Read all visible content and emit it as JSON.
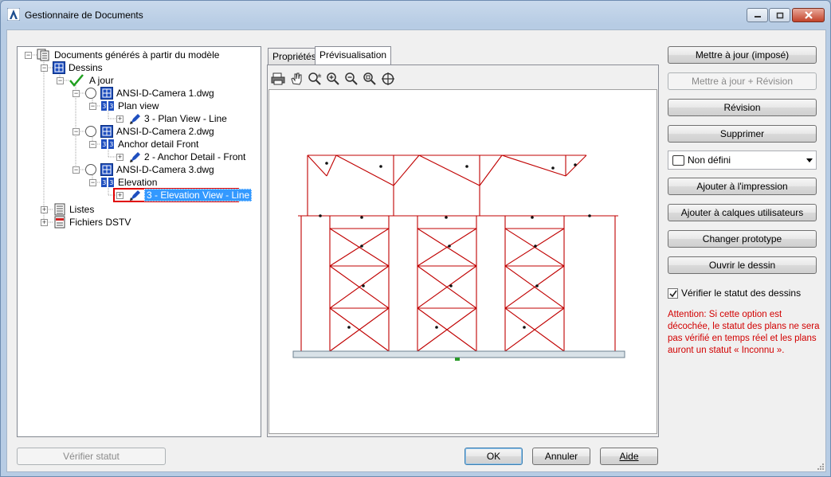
{
  "window": {
    "title": "Gestionnaire de Documents"
  },
  "tree": {
    "root": "Documents générés à partir du modèle",
    "drawings": "Dessins",
    "up_to_date": "A jour",
    "items": [
      {
        "file": "ANSI-D-Camera 1.dwg",
        "view": "Plan view",
        "child": "3 - Plan View - Line"
      },
      {
        "file": "ANSI-D-Camera 2.dwg",
        "view": "Anchor detail Front",
        "child": "2 - Anchor Detail - Front"
      },
      {
        "file": "ANSI-D-Camera 3.dwg",
        "view": "Elevation",
        "child": "3 - Elevation View - Line"
      }
    ],
    "lists": "Listes",
    "dstv": "Fichiers DSTV"
  },
  "tabs": [
    {
      "label": "Propriétés"
    },
    {
      "label": "Prévisualisation"
    }
  ],
  "buttons": {
    "update_forced": "Mettre à jour (imposé)",
    "update_revision": "Mettre à jour + Révision",
    "revision": "Révision",
    "delete": "Supprimer",
    "add_print": "Ajouter à l'impression",
    "add_layers": "Ajouter à calques utilisateurs",
    "change_prototype": "Changer prototype",
    "open_drawing": "Ouvrir le dessin",
    "verify_status": "Vérifier statut",
    "ok": "OK",
    "cancel": "Annuler",
    "help": "Aide"
  },
  "dropdown": {
    "selected": "Non défini"
  },
  "checkbox": {
    "label": "Vérifier le statut des dessins",
    "checked": true
  },
  "warning": {
    "lines": [
      "Attention: Si cette option est",
      "décochée, le statut des plans ne sera",
      "pas vérifié en temps réel et les plans",
      "auront un statut « Inconnu »."
    ]
  },
  "colors": {
    "frame": "#c00000",
    "warning": "#d20000",
    "selection": "#3399ff",
    "highlight_box": "#e00000"
  }
}
